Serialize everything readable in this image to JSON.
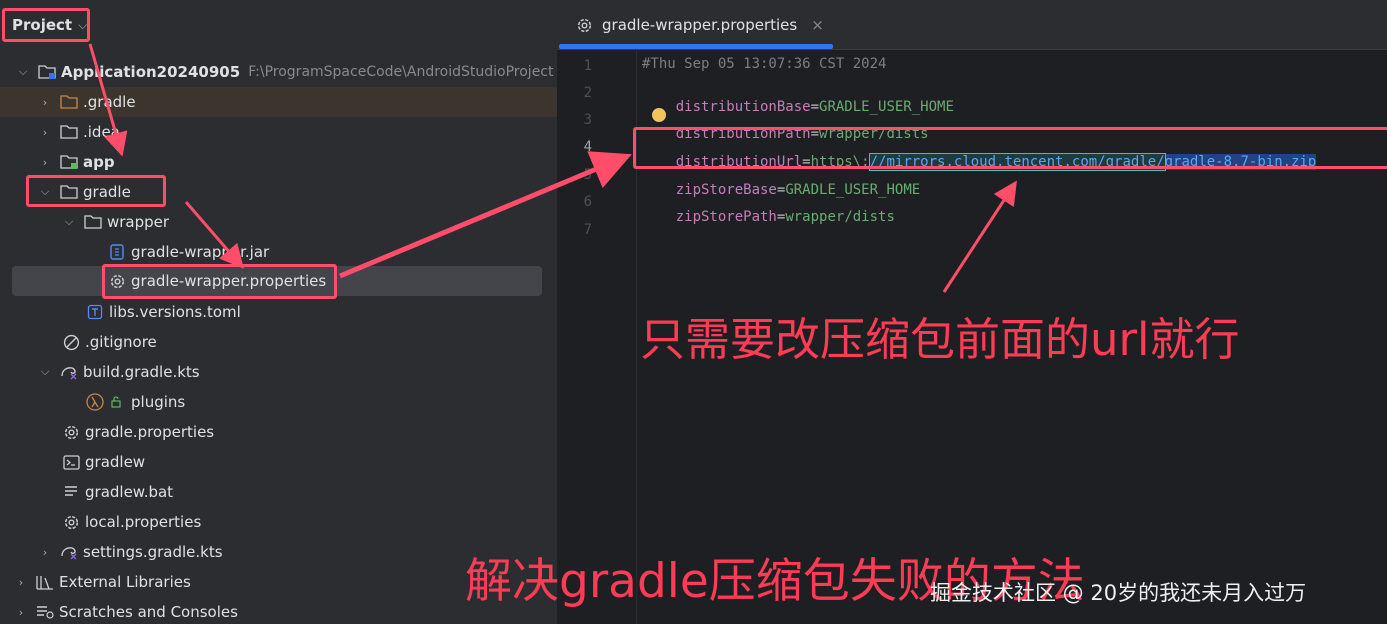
{
  "project": {
    "header_label": "Project",
    "tree": [
      {
        "label": "Application20240905",
        "hint": "F:\\ProgramSpaceCode\\AndroidStudioProject",
        "icon": "module-folder-icon",
        "expanded": true
      },
      {
        "label": ".gradle",
        "icon": "folder-icon",
        "expanded": false
      },
      {
        "label": ".idea",
        "icon": "folder-icon",
        "expanded": false
      },
      {
        "label": "app",
        "icon": "module-folder-icon",
        "expanded": false
      },
      {
        "label": "gradle",
        "icon": "folder-icon",
        "expanded": true
      },
      {
        "label": "wrapper",
        "icon": "folder-icon",
        "expanded": true
      },
      {
        "label": "gradle-wrapper.jar",
        "icon": "jar-icon"
      },
      {
        "label": "gradle-wrapper.properties",
        "icon": "gear-icon"
      },
      {
        "label": "libs.versions.toml",
        "icon": "toml-file-icon"
      },
      {
        "label": ".gitignore",
        "icon": "ignore-file-icon"
      },
      {
        "label": "build.gradle.kts",
        "icon": "gradle-kts-icon",
        "expanded": true
      },
      {
        "label": "plugins",
        "icon": "lambda-icon"
      },
      {
        "label": "gradle.properties",
        "icon": "gear-icon"
      },
      {
        "label": "gradlew",
        "icon": "terminal-icon"
      },
      {
        "label": "gradlew.bat",
        "icon": "text-file-icon"
      },
      {
        "label": "local.properties",
        "icon": "gear-icon"
      },
      {
        "label": "settings.gradle.kts",
        "icon": "gradle-kts-icon",
        "expanded": false
      },
      {
        "label": "External Libraries",
        "icon": "libraries-icon",
        "expanded": false
      },
      {
        "label": "Scratches and Consoles",
        "icon": "scratches-icon",
        "expanded": false
      }
    ]
  },
  "editor": {
    "tab_label": "gradle-wrapper.properties",
    "tab_close": "×",
    "line_numbers": [
      "1",
      "2",
      "3",
      "4",
      "5",
      "6",
      "7"
    ],
    "lines": {
      "l1": "#Thu Sep 05 13:07:36 CST 2024",
      "l2_key": "distributionBase",
      "l2_val": "GRADLE_USER_HOME",
      "l3_key": "distributionPath",
      "l3_val": "wrapper/dists",
      "l4_key": "distributionUrl",
      "l4_prefix": "https\\:",
      "l4_url_mirror": "//mirrors.cloud.tencent.com/gradle/",
      "l4_url_file": "gradle-8.7-bin.zip",
      "l5_key": "zipStoreBase",
      "l5_val": "GRADLE_USER_HOME",
      "l6_key": "zipStorePath",
      "l6_val": "wrapper/dists",
      "eq": "="
    }
  },
  "annotations": {
    "note_url": "只需要改压缩包前面的url就行",
    "title": "解决gradle压缩包失败的方法",
    "watermark": "掘金技术社区 @ 20岁的我还未月入过万",
    "color": "#ff3b55"
  }
}
